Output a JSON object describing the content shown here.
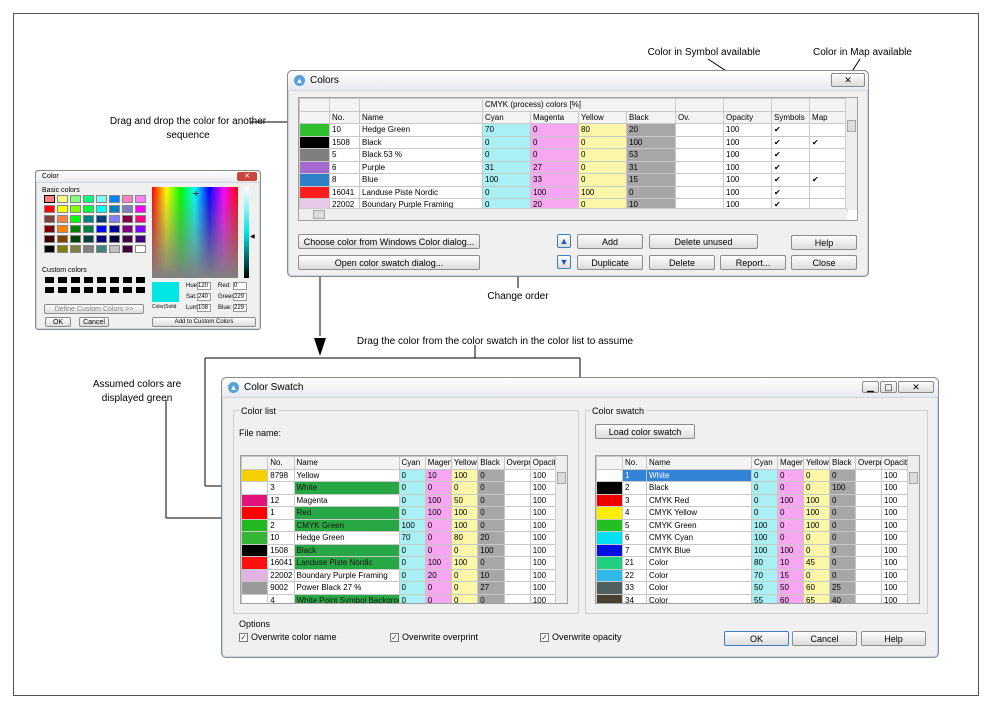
{
  "annotations": {
    "symbol_avail": "Color in Symbol available",
    "map_avail": "Color in Map available",
    "drag_sequence": "Drag and drop the color for another sequence",
    "change_order": "Change order",
    "drag_swatch": "Drag the color from the color swatch in the color list to assume",
    "assumed_green": "Assumed colors are displayed green"
  },
  "colors_window": {
    "title": "Colors",
    "group_header": "CMYK (process) colors [%]",
    "columns": [
      "No.",
      "Name",
      "Cyan",
      "Magenta",
      "Yellow",
      "Black",
      "Ov.",
      "Opacity",
      "Symbols",
      "Map"
    ],
    "rows": [
      {
        "color": "#2fbf2f",
        "no": "10",
        "name": "Hedge Green",
        "c": "70",
        "m": "0",
        "y": "80",
        "k": "20",
        "ov": "",
        "op": "100",
        "sym": "✔",
        "map": ""
      },
      {
        "color": "#000000",
        "no": "1508",
        "name": "Black",
        "c": "0",
        "m": "0",
        "y": "0",
        "k": "100",
        "ov": "",
        "op": "100",
        "sym": "✔",
        "map": "✔"
      },
      {
        "color": "#7f7f7f",
        "no": "5",
        "name": "Black 53 %",
        "c": "0",
        "m": "0",
        "y": "0",
        "k": "53",
        "ov": "",
        "op": "100",
        "sym": "✔",
        "map": ""
      },
      {
        "color": "#a56ad0",
        "no": "6",
        "name": "Purple",
        "c": "31",
        "m": "27",
        "y": "0",
        "k": "31",
        "ov": "",
        "op": "100",
        "sym": "✔",
        "map": ""
      },
      {
        "color": "#2f80c8",
        "no": "8",
        "name": "Blue",
        "c": "100",
        "m": "33",
        "y": "0",
        "k": "15",
        "ov": "",
        "op": "100",
        "sym": "✔",
        "map": "✔"
      },
      {
        "color": "#ff1d1d",
        "no": "16041",
        "name": "Landuse Piste Nordic",
        "c": "0",
        "m": "100",
        "y": "100",
        "k": "0",
        "ov": "",
        "op": "100",
        "sym": "✔",
        "map": ""
      },
      {
        "color": "#e8c8e8",
        "no": "22002",
        "name": "Boundary Purple Framing",
        "c": "0",
        "m": "20",
        "y": "0",
        "k": "10",
        "ov": "",
        "op": "100",
        "sym": "✔",
        "map": ""
      }
    ],
    "buttons": {
      "choose_windows": "Choose color from Windows Color dialog...",
      "open_swatch": "Open color swatch dialog...",
      "add": "Add",
      "delete_unused": "Delete unused",
      "help": "Help",
      "duplicate": "Duplicate",
      "delete": "Delete",
      "report": "Report...",
      "close": "Close"
    }
  },
  "win_color_dialog": {
    "title": "Color",
    "basic_colors": "Basic colors",
    "custom_colors": "Custom colors",
    "define_custom": "Define Custom Colors >>",
    "ok": "OK",
    "cancel": "Cancel",
    "add_custom": "Add to Custom Colors",
    "color_solid": "Color|Solid",
    "hue_label": "Hue:",
    "hue": "120",
    "sat_label": "Sat:",
    "sat": "240",
    "lum_label": "Lum:",
    "lum": "108",
    "red_label": "Red:",
    "red": "0",
    "green_label": "Green:",
    "green": "229",
    "blue_label": "Blue:",
    "blue": "229",
    "basic_palette": [
      "#ff8080",
      "#ffff80",
      "#80ff80",
      "#00ff80",
      "#80ffff",
      "#0080ff",
      "#ff80c0",
      "#ff80ff",
      "#ff0000",
      "#ffff00",
      "#80ff00",
      "#00ff40",
      "#00ffff",
      "#0080c0",
      "#8080c0",
      "#ff00ff",
      "#804040",
      "#ff8040",
      "#00ff00",
      "#008080",
      "#004080",
      "#8080ff",
      "#800040",
      "#ff0080",
      "#800000",
      "#ff8000",
      "#008000",
      "#008040",
      "#0000ff",
      "#0000a0",
      "#800080",
      "#8000ff",
      "#400000",
      "#804000",
      "#004000",
      "#004040",
      "#000080",
      "#000040",
      "#400040",
      "#400080",
      "#000000",
      "#808000",
      "#808040",
      "#808080",
      "#408080",
      "#c0c0c0",
      "#400040",
      "#ffffff"
    ]
  },
  "swatch_window": {
    "title": "Color Swatch",
    "color_list_label": "Color list",
    "file_name_label": "File name:",
    "color_swatch_label": "Color swatch",
    "load_button": "Load color swatch",
    "columns": [
      "No.",
      "Name",
      "Cyan",
      "Magenta",
      "Yellow",
      "Black",
      "Overprint",
      "Opacity"
    ],
    "list_rows": [
      {
        "color": "#f5d000",
        "no": "8798",
        "name": "Yellow",
        "c": "0",
        "m": "10",
        "y": "100",
        "k": "0",
        "op": "100",
        "green": false
      },
      {
        "color": "#ffffff",
        "no": "3",
        "name": "White",
        "c": "0",
        "m": "0",
        "y": "0",
        "k": "0",
        "op": "100",
        "green": true
      },
      {
        "color": "#e0147a",
        "no": "12",
        "name": "Magenta",
        "c": "0",
        "m": "100",
        "y": "50",
        "k": "0",
        "op": "100",
        "green": false
      },
      {
        "color": "#ff0000",
        "no": "1",
        "name": "Red",
        "c": "0",
        "m": "100",
        "y": "100",
        "k": "0",
        "op": "100",
        "green": true
      },
      {
        "color": "#22b822",
        "no": "2",
        "name": "CMYK Green",
        "c": "100",
        "m": "0",
        "y": "100",
        "k": "0",
        "op": "100",
        "green": true
      },
      {
        "color": "#35b535",
        "no": "10",
        "name": "Hedge Green",
        "c": "70",
        "m": "0",
        "y": "80",
        "k": "20",
        "op": "100",
        "green": false
      },
      {
        "color": "#000000",
        "no": "1508",
        "name": "Black",
        "c": "0",
        "m": "0",
        "y": "0",
        "k": "100",
        "op": "100",
        "green": true
      },
      {
        "color": "#ff1010",
        "no": "16041",
        "name": "Landuse Piste Nordic",
        "c": "0",
        "m": "100",
        "y": "100",
        "k": "0",
        "op": "100",
        "green": true
      },
      {
        "color": "#e2b4e2",
        "no": "22002",
        "name": "Boundary Purple Framing",
        "c": "0",
        "m": "20",
        "y": "0",
        "k": "10",
        "op": "100",
        "green": false
      },
      {
        "color": "#9a9a9a",
        "no": "9002",
        "name": "Power Black 27 %",
        "c": "0",
        "m": "0",
        "y": "0",
        "k": "27",
        "op": "100",
        "green": false
      },
      {
        "color": "#ffffff",
        "no": "4",
        "name": "White Point Symbol Backgrou",
        "c": "0",
        "m": "0",
        "y": "0",
        "k": "0",
        "op": "100",
        "green": true
      }
    ],
    "swatch_rows": [
      {
        "color": "#ffffff",
        "no": "1",
        "name": "White",
        "c": "0",
        "m": "0",
        "y": "0",
        "k": "0",
        "op": "100",
        "sel": true
      },
      {
        "color": "#000000",
        "no": "2",
        "name": "Black",
        "c": "0",
        "m": "0",
        "y": "0",
        "k": "100",
        "op": "100",
        "sel": false
      },
      {
        "color": "#ee0000",
        "no": "3",
        "name": "CMYK Red",
        "c": "0",
        "m": "100",
        "y": "100",
        "k": "0",
        "op": "100",
        "sel": false
      },
      {
        "color": "#ffee00",
        "no": "4",
        "name": "CMYK Yellow",
        "c": "0",
        "m": "0",
        "y": "100",
        "k": "0",
        "op": "100",
        "sel": false
      },
      {
        "color": "#22c022",
        "no": "5",
        "name": "CMYK Green",
        "c": "100",
        "m": "0",
        "y": "100",
        "k": "0",
        "op": "100",
        "sel": false
      },
      {
        "color": "#00e0f0",
        "no": "6",
        "name": "CMYK Cyan",
        "c": "100",
        "m": "0",
        "y": "0",
        "k": "0",
        "op": "100",
        "sel": false
      },
      {
        "color": "#0010e0",
        "no": "7",
        "name": "CMYK Blue",
        "c": "100",
        "m": "100",
        "y": "0",
        "k": "0",
        "op": "100",
        "sel": false
      },
      {
        "color": "#20d080",
        "no": "21",
        "name": "Color",
        "c": "80",
        "m": "10",
        "y": "45",
        "k": "0",
        "op": "100",
        "sel": false
      },
      {
        "color": "#30b8e8",
        "no": "22",
        "name": "Color",
        "c": "70",
        "m": "15",
        "y": "0",
        "k": "0",
        "op": "100",
        "sel": false
      },
      {
        "color": "#506060",
        "no": "33",
        "name": "Color",
        "c": "50",
        "m": "50",
        "y": "60",
        "k": "25",
        "op": "100",
        "sel": false
      },
      {
        "color": "#4a4030",
        "no": "34",
        "name": "Color",
        "c": "55",
        "m": "60",
        "y": "65",
        "k": "40",
        "op": "100",
        "sel": false
      }
    ],
    "options_label": "Options",
    "opt_name": "Overwrite color name",
    "opt_overprint": "Overwrite overprint",
    "opt_opacity": "Overwrite opacity",
    "ok": "OK",
    "cancel": "Cancel",
    "help": "Help"
  }
}
